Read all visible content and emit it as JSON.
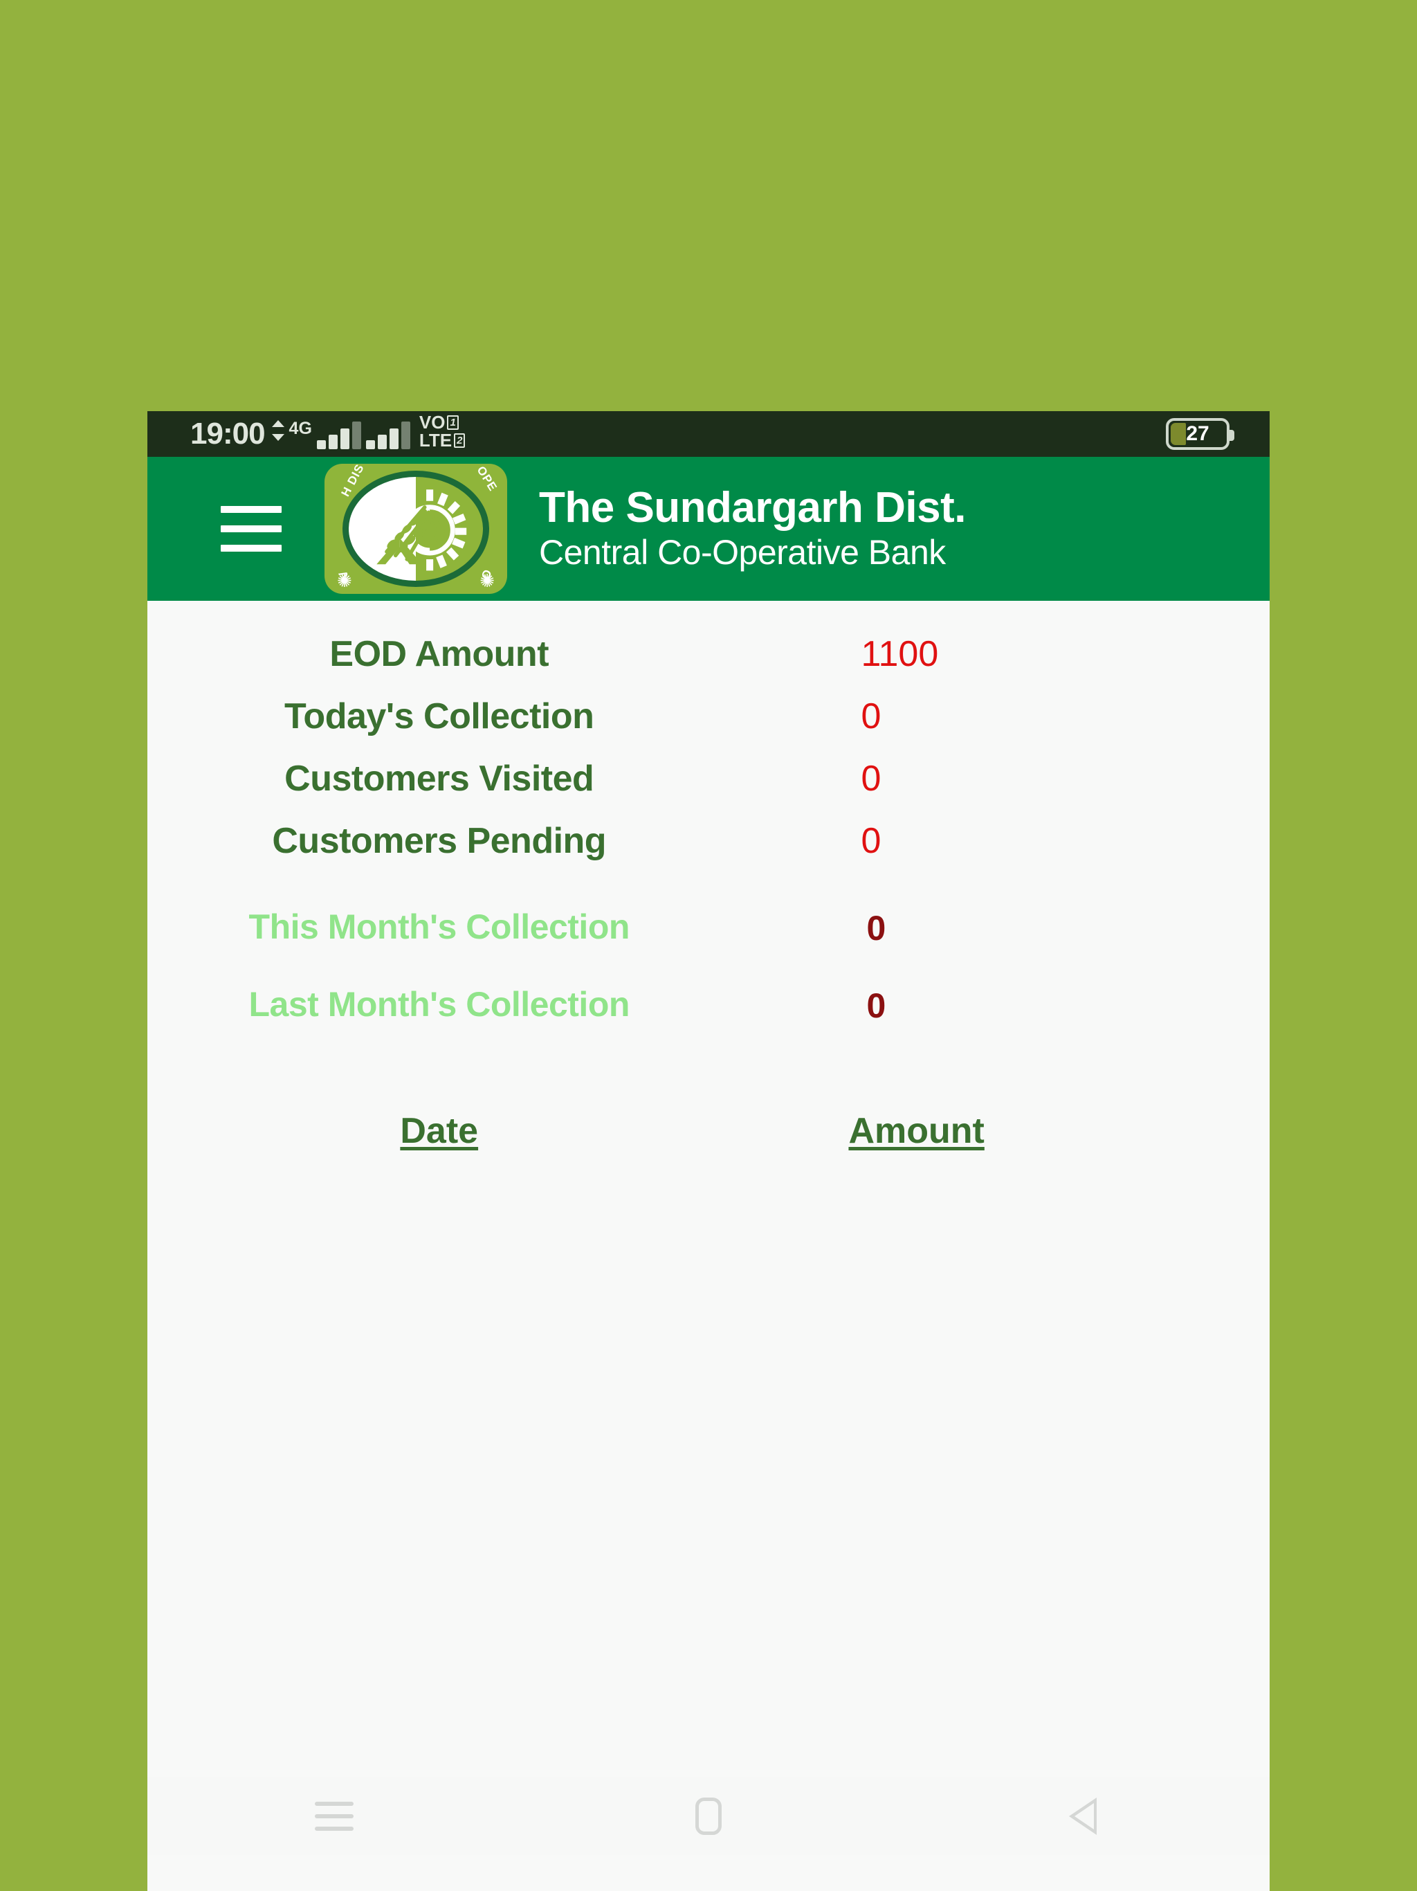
{
  "colors": {
    "page_background": "#93b23e",
    "status_bar": "#1d2e1a",
    "app_bar": "#008a48",
    "content_background": "#f8f9f8",
    "label_green": "#3a7030",
    "value_red": "#e01111",
    "month_label_green": "#90e48a",
    "month_value_maroon": "#8b1111",
    "logo_green": "#8fb53a",
    "logo_ring": "#1b6b38"
  },
  "status_bar": {
    "time": "19:00",
    "data_arrows_icon": "data-transfer-arrows-icon",
    "network_type": "4G",
    "signal_1_icon": "signal-bars-icon",
    "signal_2_icon": "signal-bars-icon",
    "volte_line1": "VO",
    "volte_line2": "LTE",
    "sim1_label": "1",
    "sim2_label": "2",
    "battery_icon": "battery-icon",
    "battery_percent": "27"
  },
  "app_bar": {
    "menu_icon": "hamburger-menu-icon",
    "logo_icon": "bank-logo-icon",
    "logo_arc_text": {
      "top_left": "H DIS",
      "top_right": "OPE",
      "bottom_left": "V",
      "bottom_right": "O"
    },
    "title": "The Sundargarh Dist.",
    "subtitle": "Central Co-Operative Bank"
  },
  "dashboard": {
    "stats": [
      {
        "label": "EOD Amount",
        "value": "1100"
      },
      {
        "label": "Today's Collection",
        "value": "0"
      },
      {
        "label": "Customers Visited",
        "value": "0"
      },
      {
        "label": "Customers Pending",
        "value": "0"
      }
    ],
    "monthly": [
      {
        "label": "This Month's Collection",
        "value": "0"
      },
      {
        "label": "Last Month's Collection",
        "value": "0"
      }
    ],
    "table": {
      "headers": {
        "date": "Date",
        "amount": "Amount"
      },
      "rows": []
    }
  },
  "nav_bar": {
    "recents_icon": "recents-icon",
    "home_icon": "home-icon",
    "back_icon": "back-icon"
  }
}
